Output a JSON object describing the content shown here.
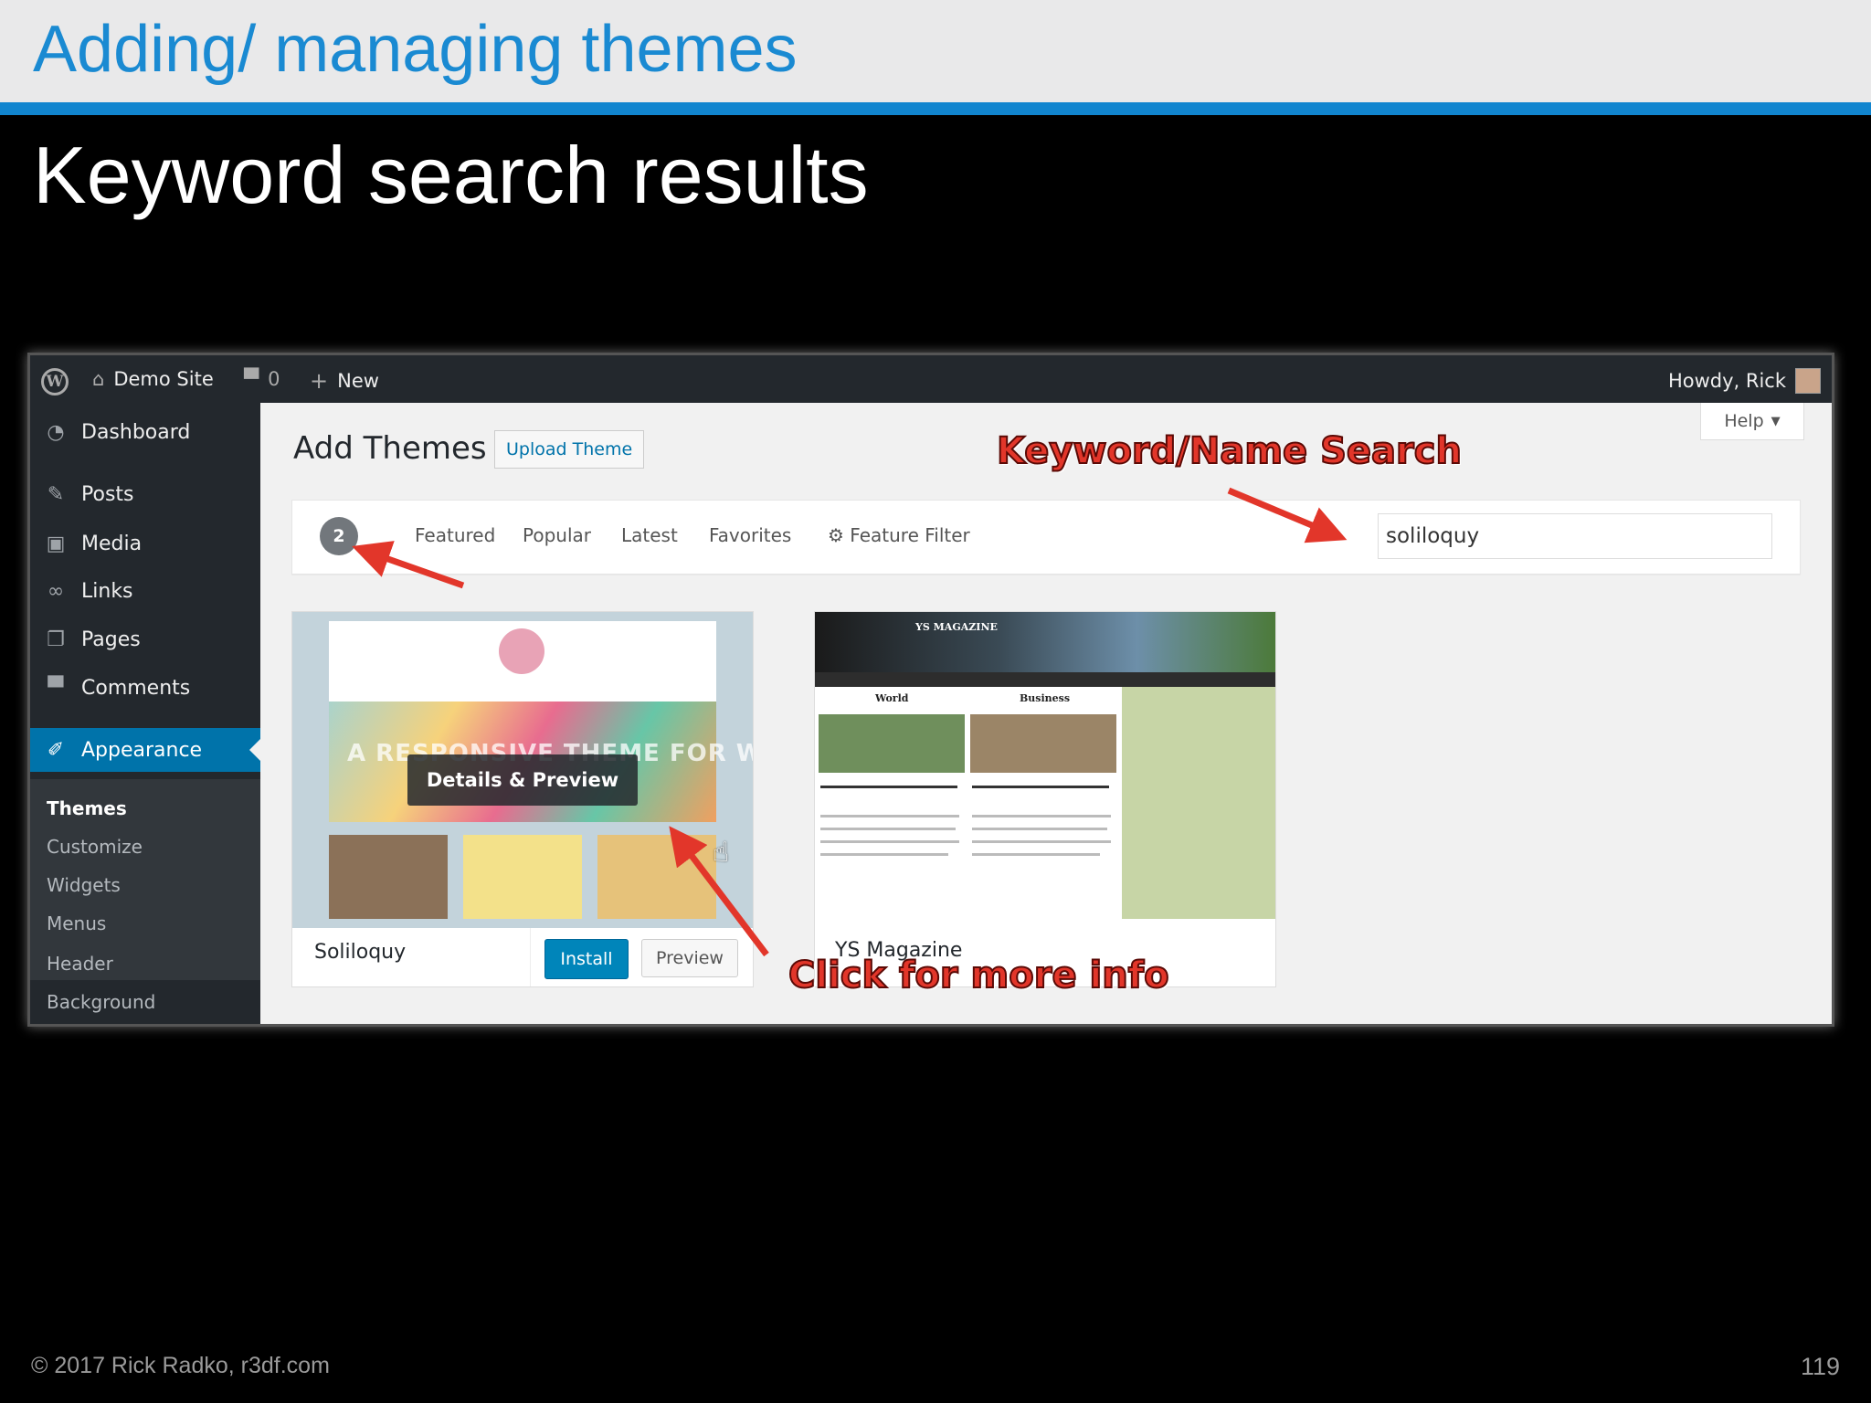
{
  "slide": {
    "title": "Adding/ managing themes",
    "subtitle": "Keyword search results",
    "footer_copyright": "© 2017 Rick Radko, r3df.com",
    "page_number": "119"
  },
  "adminbar": {
    "site_name": "Demo Site",
    "comments_count": "0",
    "new_label": "New",
    "greeting": "Howdy, Rick"
  },
  "sidebar": {
    "items": [
      {
        "label": "Dashboard",
        "icon": "dashboard-icon"
      },
      {
        "label": "Posts",
        "icon": "pin-icon"
      },
      {
        "label": "Media",
        "icon": "media-icon"
      },
      {
        "label": "Links",
        "icon": "link-icon"
      },
      {
        "label": "Pages",
        "icon": "pages-icon"
      },
      {
        "label": "Comments",
        "icon": "comment-icon"
      },
      {
        "label": "Appearance",
        "icon": "brush-icon"
      }
    ],
    "submenu": [
      "Themes",
      "Customize",
      "Widgets",
      "Menus",
      "Header",
      "Background"
    ]
  },
  "content": {
    "page_title": "Add Themes",
    "upload_label": "Upload Theme",
    "help_label": "Help",
    "result_count": "2",
    "tabs": [
      "Featured",
      "Popular",
      "Latest",
      "Favorites",
      "Feature Filter"
    ],
    "search_value": "soliloquy"
  },
  "themes": [
    {
      "name": "Soliloquy",
      "overlay_label": "Details & Preview",
      "install_label": "Install",
      "preview_label": "Preview",
      "banner_text": "A RESPONSIVE THEME FOR WORDPRESS"
    },
    {
      "name": "YS Magazine",
      "mag_title": "YS MAGAZINE",
      "col1": "World",
      "col2": "Business"
    }
  ],
  "annotations": {
    "search_note": "Keyword/Name Search",
    "info_note": "Click for more info"
  },
  "colors": {
    "accent_blue": "#1185cf",
    "wp_admin_blue": "#0073aa",
    "annotation_red": "#e2362a"
  }
}
